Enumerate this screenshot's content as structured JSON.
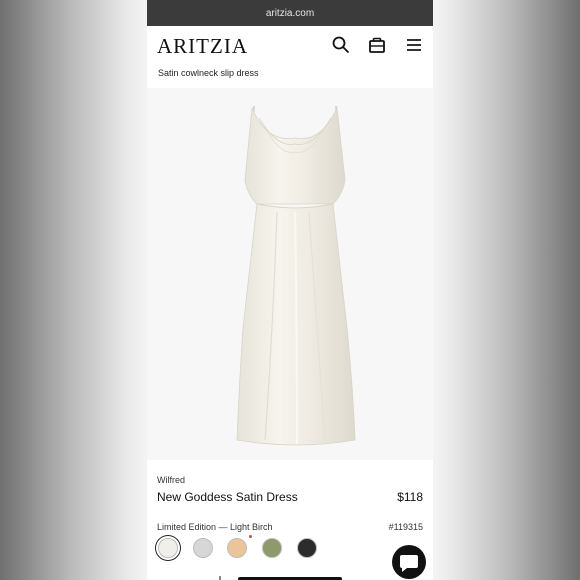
{
  "browser": {
    "url": "aritzia.com"
  },
  "header": {
    "logo": "ARITZIA",
    "icons": [
      "search-icon",
      "bag-icon",
      "menu-icon"
    ]
  },
  "breadcrumb_title": "Satin cowlneck slip dress",
  "product": {
    "brand": "Wilfred",
    "name": "New Goddess Satin Dress",
    "price": "$118",
    "color_label": "Limited Edition — Light Birch",
    "sku": "#119315",
    "swatches": [
      {
        "name": "light-birch",
        "color": "#f1efe9",
        "selected": true
      },
      {
        "name": "silver",
        "color": "#d7d7d8",
        "selected": false
      },
      {
        "name": "peach",
        "color": "#ecc49b",
        "selected": false
      },
      {
        "name": "sage",
        "color": "#8e9a6c",
        "selected": false
      },
      {
        "name": "black",
        "color": "#2c2c2c",
        "selected": false
      }
    ]
  },
  "colors": {
    "dress": "#f1efe6",
    "hero_bg": "#f7f7f7",
    "url_bar": "#3b3b3b"
  }
}
